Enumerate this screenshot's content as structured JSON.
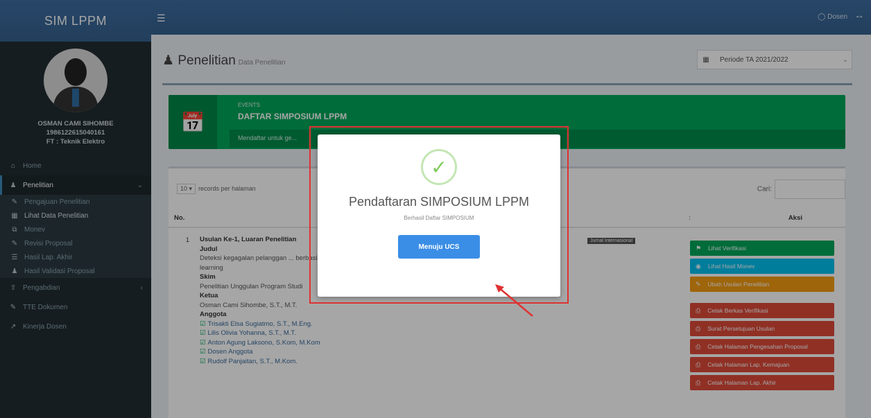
{
  "app": {
    "title": "SIM LPPM"
  },
  "user": {
    "name": "OSMAN CAMI SIHOMBE",
    "nip": "1986122615040161",
    "unit": "FT : Teknik Elektro"
  },
  "menu": [
    {
      "icon": "home-icon",
      "label": "Home"
    },
    {
      "icon": "user-icon",
      "label": "Penelitian",
      "active": true
    },
    {
      "icon": "pencil-icon",
      "label": "Pengajuan Penelitian",
      "sub": true
    },
    {
      "icon": "file-icon",
      "label": "Lihat Data Penelitian",
      "sub": true
    },
    {
      "icon": "copy-icon",
      "label": "Monev",
      "sub": true
    },
    {
      "icon": "edit-icon",
      "label": "Revisi Proposal",
      "sub": true
    },
    {
      "icon": "list-icon",
      "label": "Hasil Lap. Akhir",
      "sub": true
    },
    {
      "icon": "users-icon",
      "label": "Hasil Validasi Proposal",
      "sub": true
    },
    {
      "icon": "upload-icon",
      "label": "Pengabdian"
    },
    {
      "icon": "edit-icon",
      "label": "TTE Dokumen"
    },
    {
      "icon": "chart-icon",
      "label": "Kinerja Dosen"
    }
  ],
  "header": {
    "user_label": "Dosen"
  },
  "page": {
    "title": "Penelitian",
    "subtitle": "Data Penelitian",
    "period": "Periode TA 2021/2022"
  },
  "event": {
    "label": "EVENTS",
    "title": "DAFTAR SIMPOSIUM LPPM",
    "desc": "Mendaftar untuk ge..."
  },
  "table": {
    "length_value": "10",
    "length_text": "records per halaman",
    "search_label": "Cari:",
    "col_no": "No.",
    "col_aksi": "Aksi",
    "row_no": "1",
    "skema_title": "Usulan Ke-1, Luaran Penelitian",
    "badge": "Jurnal Internasional",
    "judul_label": "Judul",
    "judul_text": "Deteksi kegagalan pelanggan ... berbasis pembelajaran deep",
    "judul_text2": "learning",
    "skim_label": "Skim",
    "skim_text": "Penelitian Unggulan Program Studi",
    "ketua_label": "Ketua",
    "ketua_text": "Osman Cami Sihombe, S.T., M.T.",
    "anggota_label": "Anggota",
    "anggota": [
      "Trisakti Elsa Sugiatmo, S.T., M.Eng.",
      "Lilis Olivia Yohanna, S.T., M.T.",
      "Anton Agung Laksono, S.Kom, M.Kom",
      "Dosen Anggota",
      "Rudolf Panjaitan, S.T., M.Kom."
    ],
    "actions": [
      {
        "label": "Lihat Verifikasi",
        "color": "green",
        "icon": "flag-icon"
      },
      {
        "label": "Lihat Hasil Monev",
        "color": "blue",
        "icon": "eye-icon"
      },
      {
        "label": "Ubah Usulan Penelitian",
        "color": "orange",
        "icon": "edit-icon"
      },
      {
        "label": "Cetak Berkas Verifikasi",
        "color": "red",
        "icon": "print-icon"
      },
      {
        "label": "Surat Persetujuan Usulan",
        "color": "red",
        "icon": "print-icon"
      },
      {
        "label": "Cetak Halaman Pengesahan Proposal",
        "color": "red",
        "icon": "print-icon"
      },
      {
        "label": "Cetak Halaman Lap. Kemajuan",
        "color": "red",
        "icon": "print-icon"
      },
      {
        "label": "Cetak Halaman Lap. Akhir",
        "color": "red",
        "icon": "print-icon"
      }
    ]
  },
  "modal": {
    "title": "Pendaftaran SIMPOSIUM LPPM",
    "text": "Berhasil Daftar SIMPOSIUM",
    "button": "Menuju UCS"
  }
}
